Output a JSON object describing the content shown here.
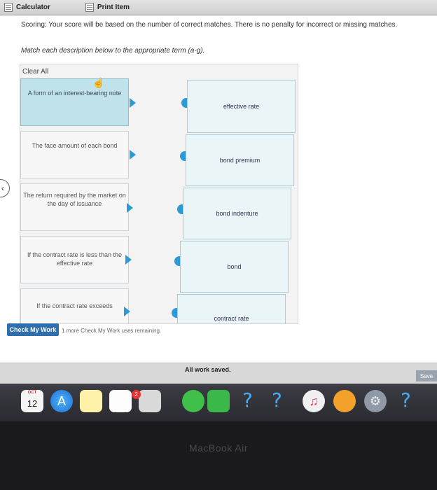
{
  "toolbar": {
    "calculator_label": "Calculator",
    "print_label": "Print Item"
  },
  "instructions": {
    "scoring": "Scoring: Your score will be based on the number of correct matches. There is no penalty for incorrect or missing matches.",
    "match": "Match each description below to the appropriate term (a-g)."
  },
  "actions": {
    "clear_all": "Clear All",
    "check_my_work": "Check My Work",
    "remaining_text": "1 more Check My Work uses remaining.",
    "save": "Save",
    "status": "All work saved."
  },
  "descriptions": [
    {
      "text": "A form of an interest-bearing note",
      "selected": true
    },
    {
      "text": "The face amount of each bond",
      "selected": false
    },
    {
      "text": "The return required by the market on the day of issuance",
      "selected": false
    },
    {
      "text": "If the contract rate is less than the effective rate",
      "selected": false
    },
    {
      "text": "If the contract rate exceeds",
      "selected": false
    }
  ],
  "terms": [
    {
      "text": "effective rate"
    },
    {
      "text": "bond premium"
    },
    {
      "text": "bond indenture"
    },
    {
      "text": "bond"
    },
    {
      "text": "contract rate"
    }
  ],
  "dock": {
    "calendar_month": "OCT",
    "calendar_day": "12",
    "reminders_badge": "2",
    "icons": [
      "calendar-icon",
      "app-store-icon",
      "notes-icon",
      "reminders-icon",
      "preview-icon",
      "photos-icon",
      "messages-icon",
      "facetime-icon",
      "unknown-app-icon",
      "unknown-app-icon",
      "music-icon",
      "books-icon",
      "system-preferences-icon",
      "unknown-app-icon"
    ],
    "unknown_glyph": "?"
  },
  "device_label": "MacBook Air",
  "colors": {
    "selected_card": "#bfe2eb",
    "term_card": "#e9f5f7",
    "connector": "#2d9ad6",
    "check_button": "#2f6fad"
  }
}
